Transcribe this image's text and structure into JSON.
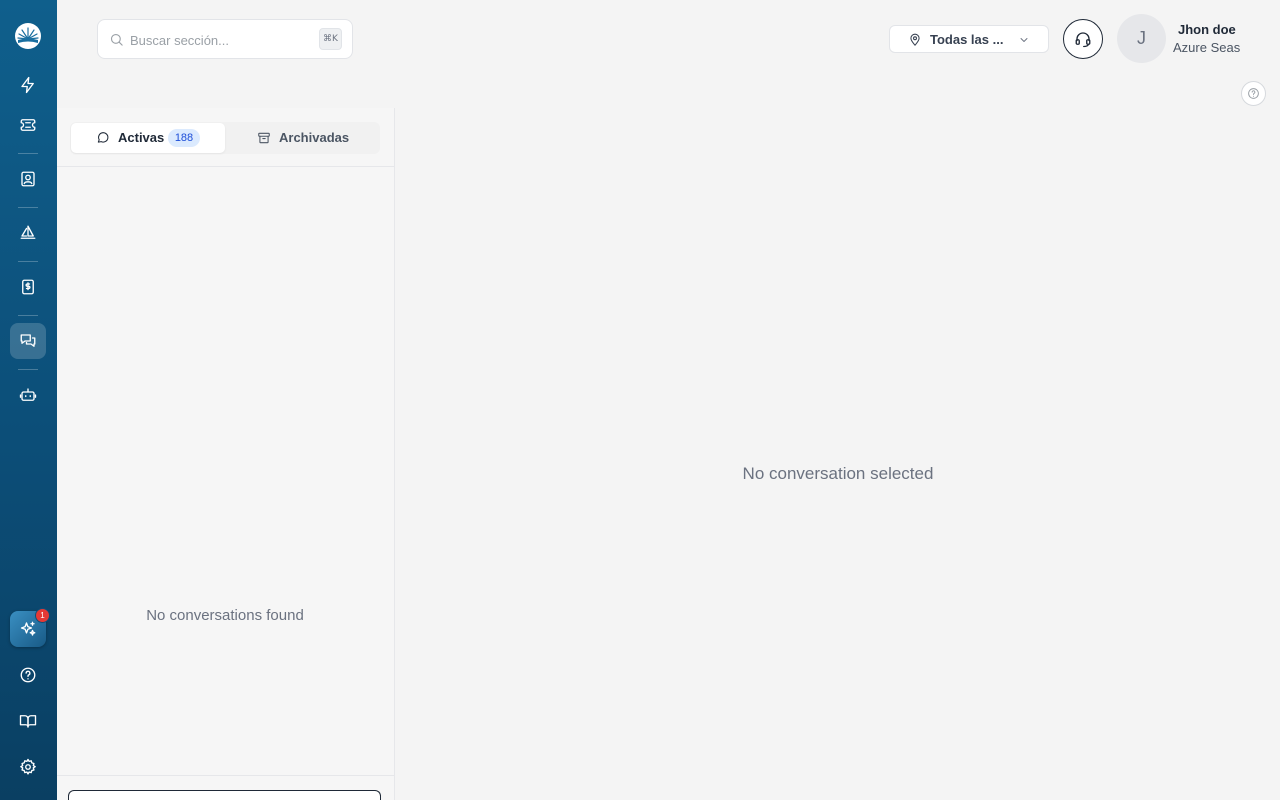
{
  "search": {
    "placeholder": "Buscar sección...",
    "shortcut": "⌘K"
  },
  "location_filter": {
    "label": "Todas las ..."
  },
  "user": {
    "initial": "J",
    "name": "Jhon doe",
    "organization": "Azure Seas"
  },
  "sidebar": {
    "items": [
      {
        "name": "lightning-icon",
        "active": false
      },
      {
        "name": "ticket-icon",
        "active": false
      },
      {
        "name": "contact-icon",
        "active": false
      },
      {
        "name": "sailboat-icon",
        "active": false
      },
      {
        "name": "dollar-receipt-icon",
        "active": false
      },
      {
        "name": "messages-icon",
        "active": true
      },
      {
        "name": "bot-icon",
        "active": false
      }
    ],
    "ai_badge_count": "1",
    "bottom_items": [
      "help-icon",
      "book-icon",
      "settings-icon"
    ]
  },
  "tabs": [
    {
      "label": "Activas",
      "count": "188",
      "active": true,
      "icon": "message-circle-icon"
    },
    {
      "label": "Archivadas",
      "active": false,
      "icon": "archive-icon"
    }
  ],
  "conversation_list": {
    "empty_message": "No conversations found"
  },
  "main": {
    "empty_message": "No conversation selected"
  },
  "colors": {
    "sidebar": "#0c4e78",
    "badge": "#e53935",
    "count_bg": "#dbeafe",
    "count_text": "#1d4ed8"
  }
}
